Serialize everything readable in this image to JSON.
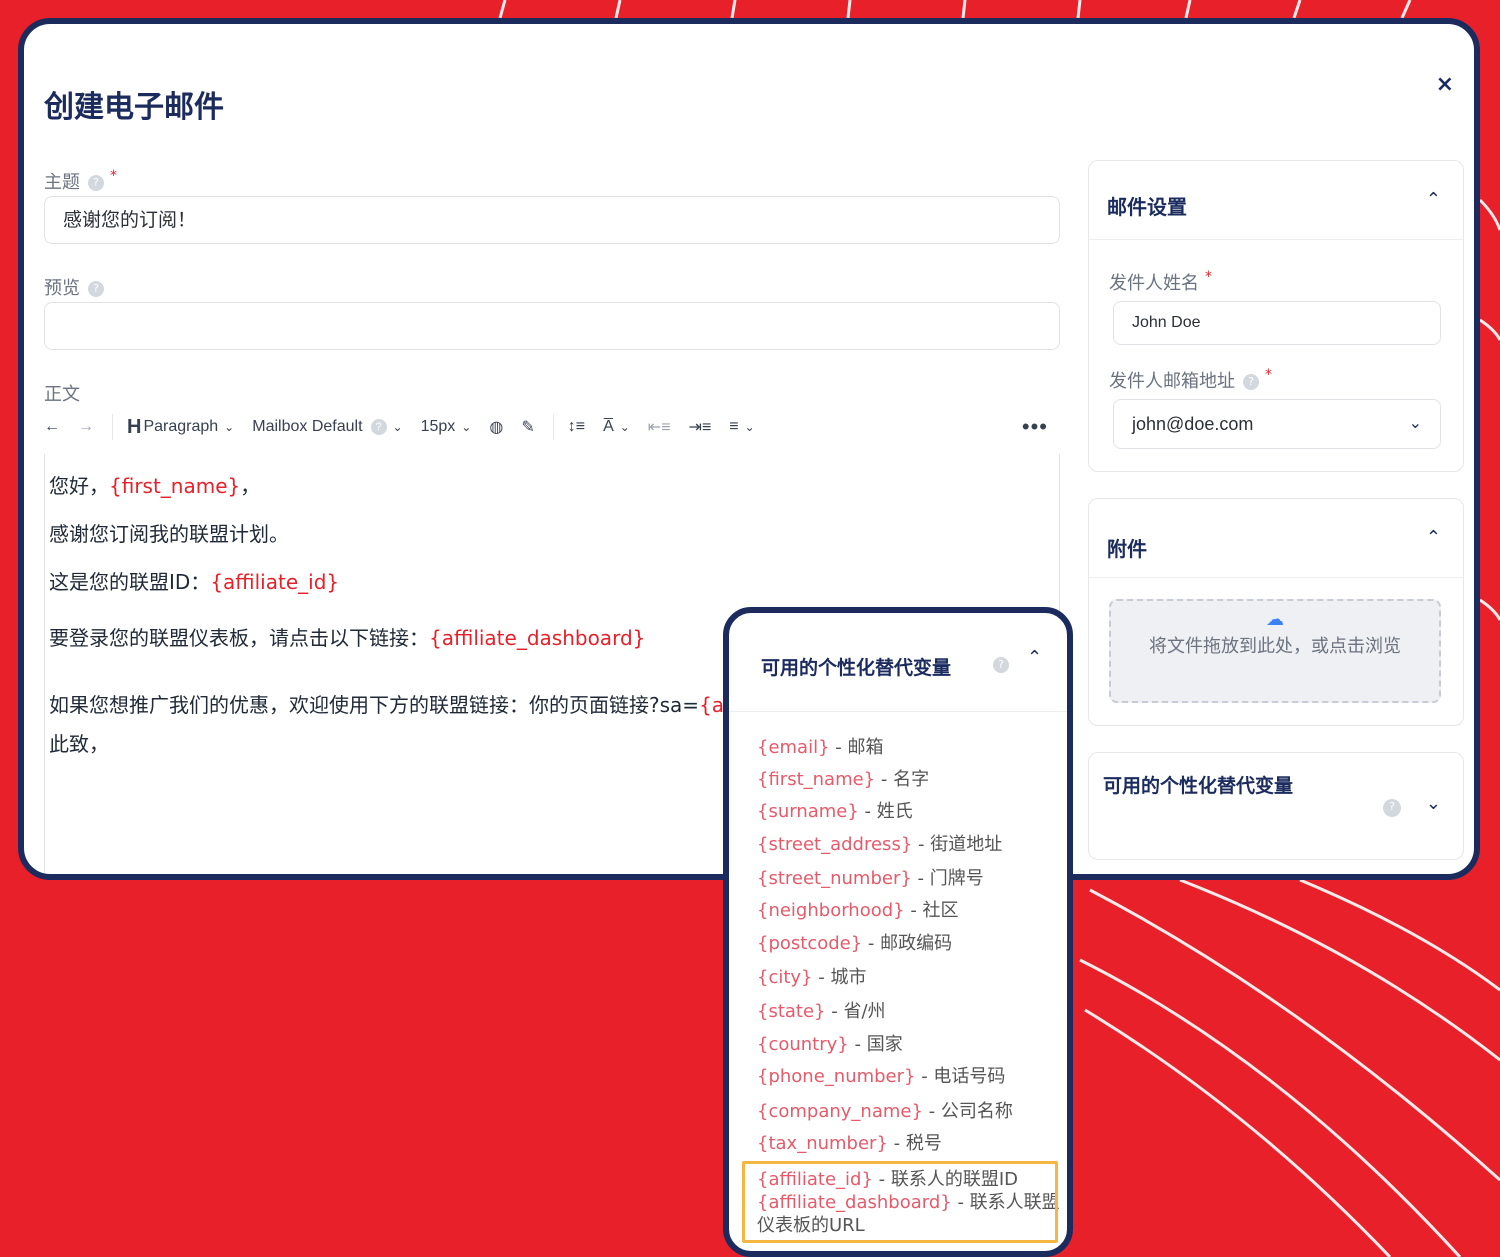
{
  "modal": {
    "title": "创建电子邮件",
    "close_label": "×"
  },
  "form": {
    "subject_label": "主题",
    "subject_value": "感谢您的订阅！",
    "preview_label": "预览",
    "preview_value": "",
    "body_label": "正文"
  },
  "toolbar": {
    "paragraph": "Paragraph",
    "font": "Mailbox Default",
    "size": "15px",
    "more": "•••"
  },
  "editor": {
    "line1_a": "您好，",
    "line1_var": "{first_name}",
    "line1_b": "，",
    "line2": "感谢您订阅我的联盟计划。",
    "line3_a": "这是您的联盟ID：",
    "line3_var": "{affiliate_id}",
    "line4_a": "要登录您的联盟仪表板，请点击以下链接：",
    "line4_var": "{affiliate_dashboard}",
    "line5_a": "如果您想推广我们的优惠，欢迎使用下方的联盟链接：你的页面链接?sa=",
    "line5_var": "{a",
    "line6": "此致，"
  },
  "mail_settings": {
    "title": "邮件设置",
    "sender_name_label": "发件人姓名",
    "sender_name_value": "John Doe",
    "sender_email_label": "发件人邮箱地址",
    "sender_email_value": "john@doe.com"
  },
  "attachments": {
    "title": "附件",
    "dropzone_text": "将文件拖放到此处，或点击浏览"
  },
  "vars_card": {
    "title": "可用的个性化替代变量"
  },
  "vars_panel": {
    "title": "可用的个性化替代变量",
    "items": [
      {
        "var": "{email}",
        "desc": " - 邮箱"
      },
      {
        "var": "{first_name}",
        "desc": " - 名字"
      },
      {
        "var": "{surname}",
        "desc": " - 姓氏"
      },
      {
        "var": "{street_address}",
        "desc": " - 街道地址"
      },
      {
        "var": "{street_number}",
        "desc": " - 门牌号"
      },
      {
        "var": "{neighborhood}",
        "desc": " - 社区"
      },
      {
        "var": "{postcode}",
        "desc": " - 邮政编码"
      },
      {
        "var": "{city}",
        "desc": " - 城市"
      },
      {
        "var": "{state}",
        "desc": " - 省/州"
      },
      {
        "var": "{country}",
        "desc": " - 国家"
      },
      {
        "var": "{phone_number}",
        "desc": " - 电话号码"
      },
      {
        "var": "{company_name}",
        "desc": " - 公司名称"
      },
      {
        "var": "{tax_number}",
        "desc": " - 税号"
      },
      {
        "var": "{affiliate_id}",
        "desc": " - 联系人的联盟ID"
      },
      {
        "var": "{affiliate_dashboard}",
        "desc": " - 联系人联盟"
      },
      {
        "var": "",
        "desc": "仪表板的URL"
      }
    ]
  },
  "colors": {
    "brand_navy": "#1b2b5e",
    "background_red": "#e8202a",
    "variable_red": "#e8202a",
    "highlight": "#f5b642"
  }
}
